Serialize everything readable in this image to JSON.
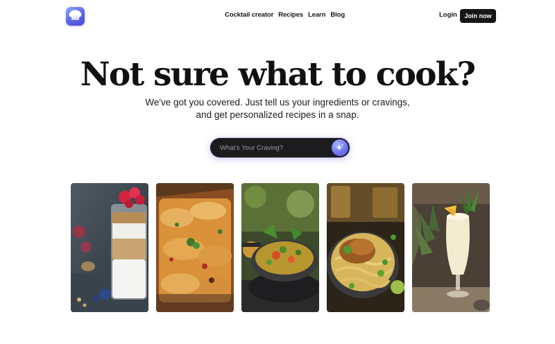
{
  "nav": {
    "logo_icon": "chef-hat-icon",
    "links": [
      "Cocktail creator",
      "Recipes",
      "Learn",
      "Blog"
    ],
    "login": "Login",
    "join": "Join now"
  },
  "hero": {
    "title": "Not sure what to cook?",
    "subtitle_line1": "We've got you covered. Just tell us your ingredients or cravings,",
    "subtitle_line2": "and get personalized recipes in a snap."
  },
  "search": {
    "placeholder": "What's Your Craving?",
    "button_icon": "sparkle-icon"
  },
  "cards": [
    {
      "icon": "parfait-photo"
    },
    {
      "icon": "enchiladas-photo"
    },
    {
      "icon": "soup-pan-photo"
    },
    {
      "icon": "chicken-noodles-photo"
    },
    {
      "icon": "pina-colada-photo"
    }
  ],
  "colors": {
    "accent": "#6a71f0",
    "dark": "#161616",
    "search_bg": "#1c1c1e"
  }
}
